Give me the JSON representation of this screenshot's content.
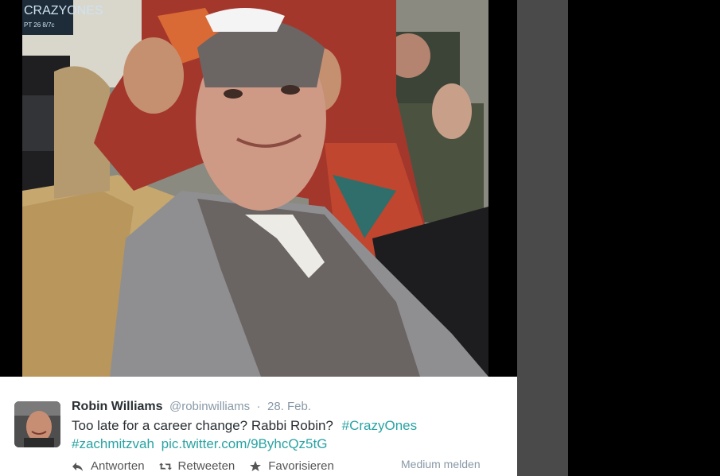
{
  "tweet": {
    "name": "Robin Williams",
    "handle": "@robinwilliams",
    "separator": "·",
    "date": "28. Feb.",
    "text_plain": "Too late for a career change?  Rabbi Robin?",
    "hashtag1": "#CrazyOnes",
    "hashtag2": "#zachmitzvah",
    "link": "pic.twitter.com/9ByhcQz5tG",
    "actions": {
      "reply": "Antworten",
      "retweet": "Retweeten",
      "favorite": "Favorisieren"
    },
    "report": "Medium melden"
  },
  "photo_overlay": {
    "sign_text": "CRAZYONES",
    "sign_sub": "PT 26 8/7c"
  },
  "colors": {
    "link": "#2aa3a3",
    "name": "#292f33",
    "meta": "#8899a6",
    "action": "#555555"
  },
  "icons": [
    "reply-icon",
    "retweet-icon",
    "star-icon"
  ]
}
